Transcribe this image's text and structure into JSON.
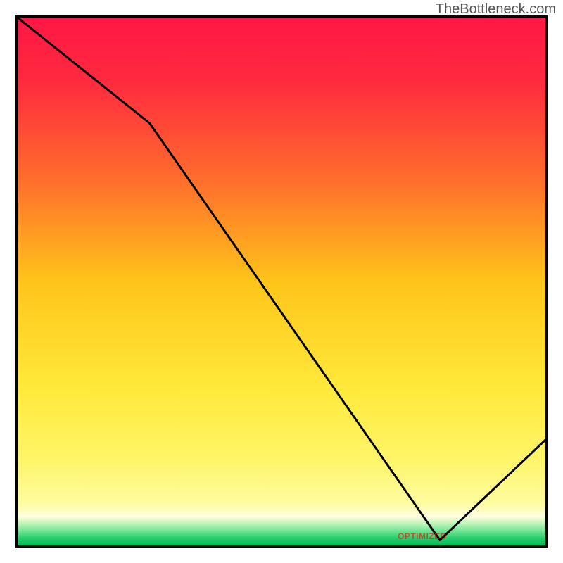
{
  "watermark": "TheBottleneck.com",
  "watermark_optimal": "OPTIMIZED",
  "chart_data": {
    "type": "line",
    "title": "",
    "xlabel": "",
    "ylabel": "",
    "xlim": [
      0,
      100
    ],
    "ylim": [
      0,
      100
    ],
    "x": [
      0,
      25,
      80,
      100
    ],
    "y": [
      100,
      80,
      1,
      20
    ],
    "gradient_stops": [
      {
        "offset": 0,
        "color": "#ff1744"
      },
      {
        "offset": 0.12,
        "color": "#ff2a3f"
      },
      {
        "offset": 0.3,
        "color": "#ff6a2d"
      },
      {
        "offset": 0.5,
        "color": "#ffc41a"
      },
      {
        "offset": 0.7,
        "color": "#ffe93a"
      },
      {
        "offset": 0.84,
        "color": "#fff56a"
      },
      {
        "offset": 0.92,
        "color": "#fffca0"
      },
      {
        "offset": 0.945,
        "color": "#fffde0"
      },
      {
        "offset": 0.955,
        "color": "#d2f8c0"
      },
      {
        "offset": 0.97,
        "color": "#7ee89a"
      },
      {
        "offset": 0.985,
        "color": "#2dd06f"
      },
      {
        "offset": 1.0,
        "color": "#00b956"
      }
    ],
    "optimal_marker_x": 80
  }
}
